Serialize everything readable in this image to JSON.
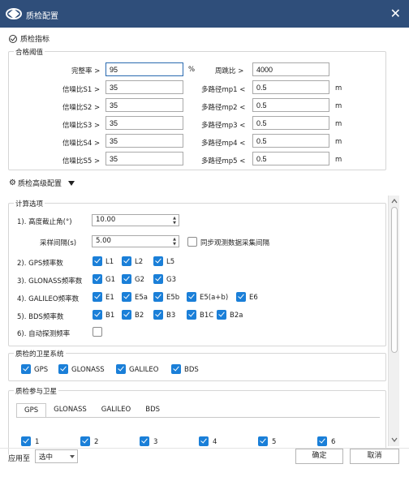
{
  "window": {
    "title": "质检配置",
    "close_glyph": "✕"
  },
  "metrics_header": "质检指标",
  "pass_threshold": {
    "title": "合格阈值",
    "completeness": {
      "label": "完整率 >",
      "value": "95",
      "unit": "%"
    },
    "cycle_slip_ratio": {
      "label": "周跳比 >",
      "value": "4000"
    },
    "snr": [
      {
        "label": "信噪比S1 >",
        "value": "35"
      },
      {
        "label": "信噪比S2 >",
        "value": "35"
      },
      {
        "label": "信噪比S3 >",
        "value": "35"
      },
      {
        "label": "信噪比S4 >",
        "value": "35"
      },
      {
        "label": "信噪比S5 >",
        "value": "35"
      }
    ],
    "multipath": [
      {
        "label": "多路径mp1 <",
        "value": "0.5",
        "unit": "m"
      },
      {
        "label": "多路径mp2 <",
        "value": "0.5",
        "unit": "m"
      },
      {
        "label": "多路径mp3 <",
        "value": "0.5",
        "unit": "m"
      },
      {
        "label": "多路径mp4 <",
        "value": "0.5",
        "unit": "m"
      },
      {
        "label": "多路径mp5 <",
        "value": "0.5",
        "unit": "m"
      }
    ]
  },
  "advanced": {
    "label": "质检高级配置",
    "icon": "gear-icon"
  },
  "calc_options": {
    "title": "计算选项",
    "elevation": {
      "label": "1).  高度截止角(°)",
      "value": "10.00"
    },
    "sample_interval": {
      "label": "采样间隔(s)",
      "value": "5.00"
    },
    "sync_label": "同步观测数据采集间隔",
    "gps": {
      "label": "2).  GPS频率数",
      "items": [
        {
          "label": "L1",
          "checked": true
        },
        {
          "label": "L2",
          "checked": true
        },
        {
          "label": "L5",
          "checked": true
        }
      ]
    },
    "glonass": {
      "label": "3).  GLONASS频率数",
      "items": [
        {
          "label": "G1",
          "checked": true
        },
        {
          "label": "G2",
          "checked": true
        },
        {
          "label": "G3",
          "checked": true
        }
      ]
    },
    "galileo": {
      "label": "4).  GALILEO频率数",
      "items": [
        {
          "label": "E1",
          "checked": true
        },
        {
          "label": "E5a",
          "checked": true
        },
        {
          "label": "E5b",
          "checked": true
        },
        {
          "label": "E5(a+b)",
          "checked": true
        },
        {
          "label": "E6",
          "checked": true
        }
      ]
    },
    "bds": {
      "label": "5).  BDS频率数",
      "items": [
        {
          "label": "B1",
          "checked": true
        },
        {
          "label": "B2",
          "checked": true
        },
        {
          "label": "B3",
          "checked": true
        },
        {
          "label": "B1C",
          "checked": true
        },
        {
          "label": "B2a",
          "checked": true
        }
      ]
    },
    "auto_detect": {
      "label": "6).  自动探测频率",
      "checked": false
    }
  },
  "satellite_systems": {
    "title": "质检的卫星系统",
    "items": [
      {
        "label": "GPS",
        "checked": true
      },
      {
        "label": "GLONASS",
        "checked": true
      },
      {
        "label": "GALILEO",
        "checked": true
      },
      {
        "label": "BDS",
        "checked": true
      }
    ]
  },
  "participating": {
    "title": "质检参与卫星",
    "tabs": [
      "GPS",
      "GLONASS",
      "GALILEO",
      "BDS"
    ],
    "active_tab": "GPS",
    "sats": [
      "1",
      "2",
      "3",
      "4",
      "5",
      "6"
    ]
  },
  "footer": {
    "apply_label": "应用至",
    "apply_value": "选中",
    "ok": "确定",
    "cancel": "取消"
  },
  "colors": {
    "titlebar": "#2f4e7a",
    "checkbox": "#1a7fd8"
  }
}
